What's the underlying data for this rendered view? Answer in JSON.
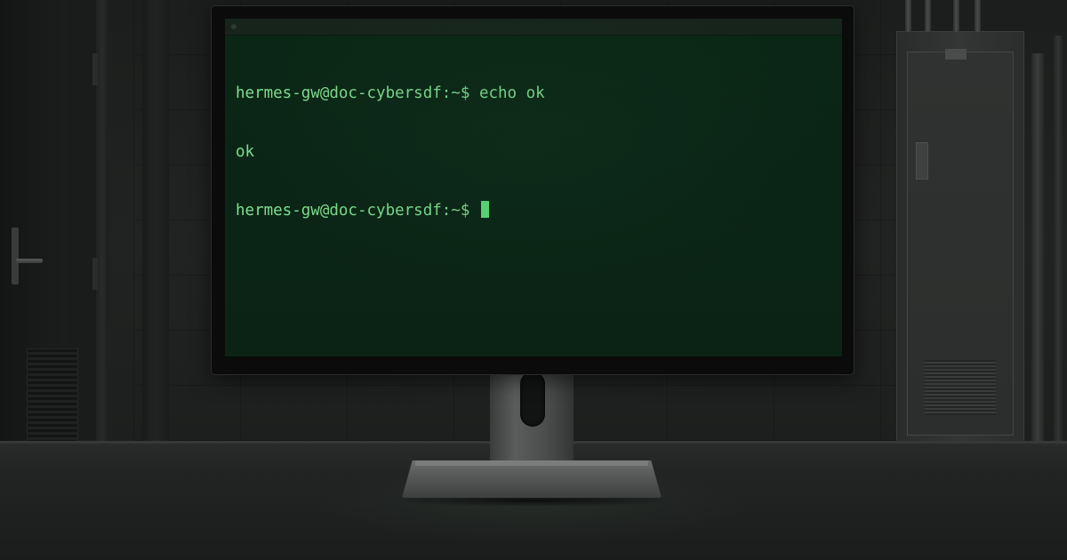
{
  "terminal": {
    "lines": [
      {
        "prompt": "hermes-gw@doc-cybersdf:~$",
        "command": " echo ok"
      },
      {
        "output": "ok"
      },
      {
        "prompt": "hermes-gw@doc-cybersdf:~$",
        "command": " "
      }
    ],
    "text_color": "#7fe08f",
    "background_color": "#0b2716",
    "cursor_color": "#5ce07a"
  },
  "scene": {
    "icons": [
      "terminal-window-close-icon",
      "door-handle-icon"
    ]
  }
}
